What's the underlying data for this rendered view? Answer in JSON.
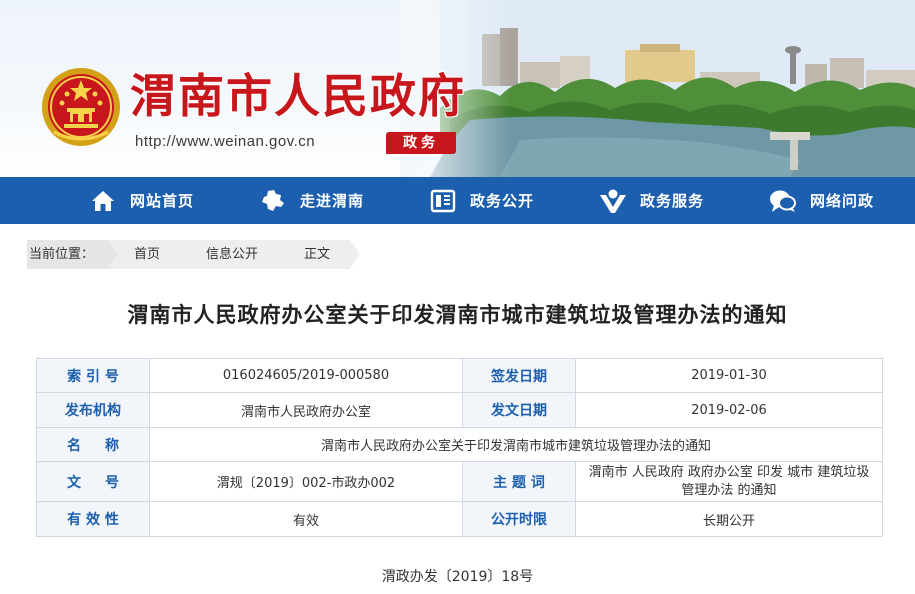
{
  "header": {
    "site_title": "渭南市人民政府",
    "site_url": "http://www.weinan.gov.cn",
    "section_tag": "政务",
    "emblem_icon": "national-emblem-icon",
    "brand_red": "#c8161d"
  },
  "nav": {
    "bg_color": "#1c5fae",
    "items": [
      {
        "label": "网站首页",
        "icon": "home-icon"
      },
      {
        "label": "走进渭南",
        "icon": "map-region-icon"
      },
      {
        "label": "政务公开",
        "icon": "document-icon"
      },
      {
        "label": "政务服务",
        "icon": "service-person-icon"
      },
      {
        "label": "网络问政",
        "icon": "chat-bubble-icon"
      }
    ]
  },
  "breadcrumb": {
    "prefix": "当前位置：",
    "items": [
      "首页",
      "信息公开",
      "正文"
    ]
  },
  "article": {
    "title": "渭南市人民政府办公室关于印发渭南市城市建筑垃圾管理办法的通知",
    "doc_number": "渭政办发〔2019〕18号"
  },
  "info": {
    "index_label": "索 引 号",
    "index_value": "016024605/2019-000580",
    "sign_date_label": "签发日期",
    "sign_date_value": "2019-01-30",
    "issuer_label": "发布机构",
    "issuer_value": "渭南市人民政府办公室",
    "issue_date_label": "发文日期",
    "issue_date_value": "2019-02-06",
    "name_label_a": "名",
    "name_label_b": "称",
    "name_value": "渭南市人民政府办公室关于印发渭南市城市建筑垃圾管理办法的通知",
    "docno_label_a": "文",
    "docno_label_b": "号",
    "docno_value": "渭规〔2019〕002-市政办002",
    "keywords_label": "主 题 词",
    "keywords_value": "渭南市 人民政府 政府办公室 印发 城市 建筑垃圾 管理办法 的通知",
    "validity_label": "有 效 性",
    "validity_value": "有效",
    "publicity_label": "公开时限",
    "publicity_value": "长期公开"
  }
}
